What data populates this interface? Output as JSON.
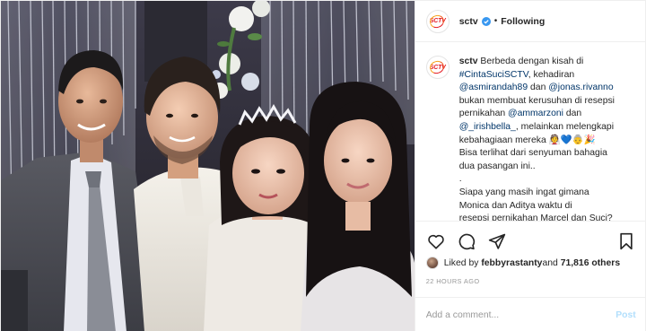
{
  "account": {
    "username": "sctv",
    "follow_separator": "•",
    "follow_status": "Following",
    "logo_text": "SCTV"
  },
  "caption": {
    "username": "sctv",
    "lines": [
      {
        "parts": [
          {
            "t": "Berbeda dengan kisah di",
            "k": "text"
          }
        ]
      },
      {
        "parts": [
          {
            "t": "#CintaSuciSCTV",
            "k": "link"
          },
          {
            "t": ", kehadiran",
            "k": "text"
          }
        ]
      },
      {
        "parts": [
          {
            "t": "@asmirandah89",
            "k": "link"
          },
          {
            "t": " dan ",
            "k": "text"
          },
          {
            "t": "@jonas.rivanno",
            "k": "link"
          }
        ]
      },
      {
        "parts": [
          {
            "t": "bukan membuat kerusuhan di resepsi",
            "k": "text"
          }
        ]
      },
      {
        "parts": [
          {
            "t": "pernikahan ",
            "k": "text"
          },
          {
            "t": "@ammarzoni",
            "k": "link"
          },
          {
            "t": " dan",
            "k": "text"
          }
        ]
      },
      {
        "parts": [
          {
            "t": "@_irishbella_",
            "k": "link"
          },
          {
            "t": ", melainkan melengkapi",
            "k": "text"
          }
        ]
      },
      {
        "parts": [
          {
            "t": "kebahagiaan mereka 👰💙👵🎉",
            "k": "text"
          }
        ]
      },
      {
        "parts": [
          {
            "t": "Bisa terlihat dari senyuman bahagia",
            "k": "text"
          }
        ]
      },
      {
        "parts": [
          {
            "t": "dua pasangan ini..",
            "k": "text"
          }
        ]
      },
      {
        "parts": [
          {
            "t": ".",
            "k": "text"
          }
        ]
      },
      {
        "parts": [
          {
            "t": "Siapa yang masih ingat gimana",
            "k": "text"
          }
        ]
      },
      {
        "parts": [
          {
            "t": "Monica dan Aditya waktu di",
            "k": "text"
          }
        ]
      },
      {
        "parts": [
          {
            "t": "resepsi pernikahan Marcel dan Suci?",
            "k": "text"
          }
        ]
      }
    ]
  },
  "actions": {
    "like_icon": "heart-icon",
    "comment_icon": "comment-icon",
    "share_icon": "share-icon",
    "save_icon": "bookmark-icon"
  },
  "likes": {
    "prefix": "Liked by ",
    "user": "febbyrastanty",
    "middle": " and ",
    "others": "71,816 others"
  },
  "timestamp": "22 HOURS AGO",
  "comment_box": {
    "placeholder": "Add a comment...",
    "post_label": "Post"
  },
  "colors": {
    "link": "#003569",
    "verified": "#3897f0",
    "post_disabled": "#b2dffc",
    "muted": "#999999"
  }
}
